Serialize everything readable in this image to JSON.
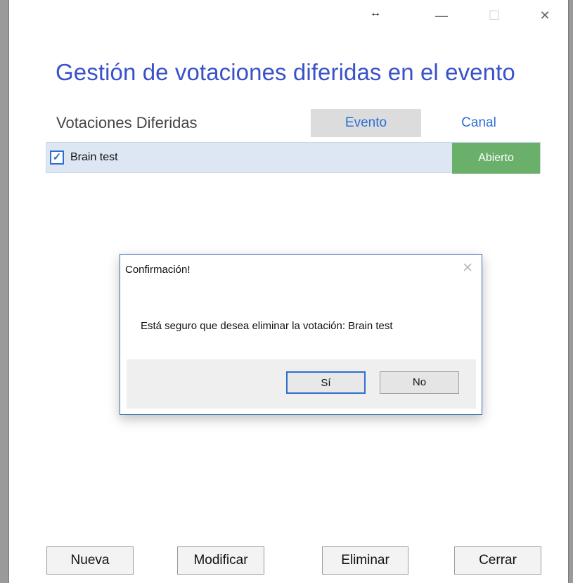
{
  "window": {
    "title": "Gestión de votaciones diferidas en el evento",
    "controls": {
      "minimize": "—",
      "maximize": "☐",
      "close": "✕"
    },
    "resize_glyph": "↔"
  },
  "main": {
    "section_label": "Votaciones Diferidas",
    "tabs": [
      {
        "label": "Evento",
        "selected": true
      },
      {
        "label": "Canal",
        "selected": false
      }
    ],
    "rows": [
      {
        "checked": true,
        "name": "Brain test",
        "status": "Abierto",
        "status_color": "#6ab06b"
      }
    ]
  },
  "actions": {
    "new": "Nueva",
    "modify": "Modificar",
    "delete": "Eliminar",
    "close": "Cerrar"
  },
  "dialog": {
    "title": "Confirmación!",
    "message": "Está seguro que desea eliminar la votación: Brain test",
    "yes": "Sí",
    "no": "No",
    "close_glyph": "✕"
  },
  "colors": {
    "title": "#3a52c9",
    "tab_text": "#2b6fd8",
    "accent": "#2f6fd0"
  }
}
